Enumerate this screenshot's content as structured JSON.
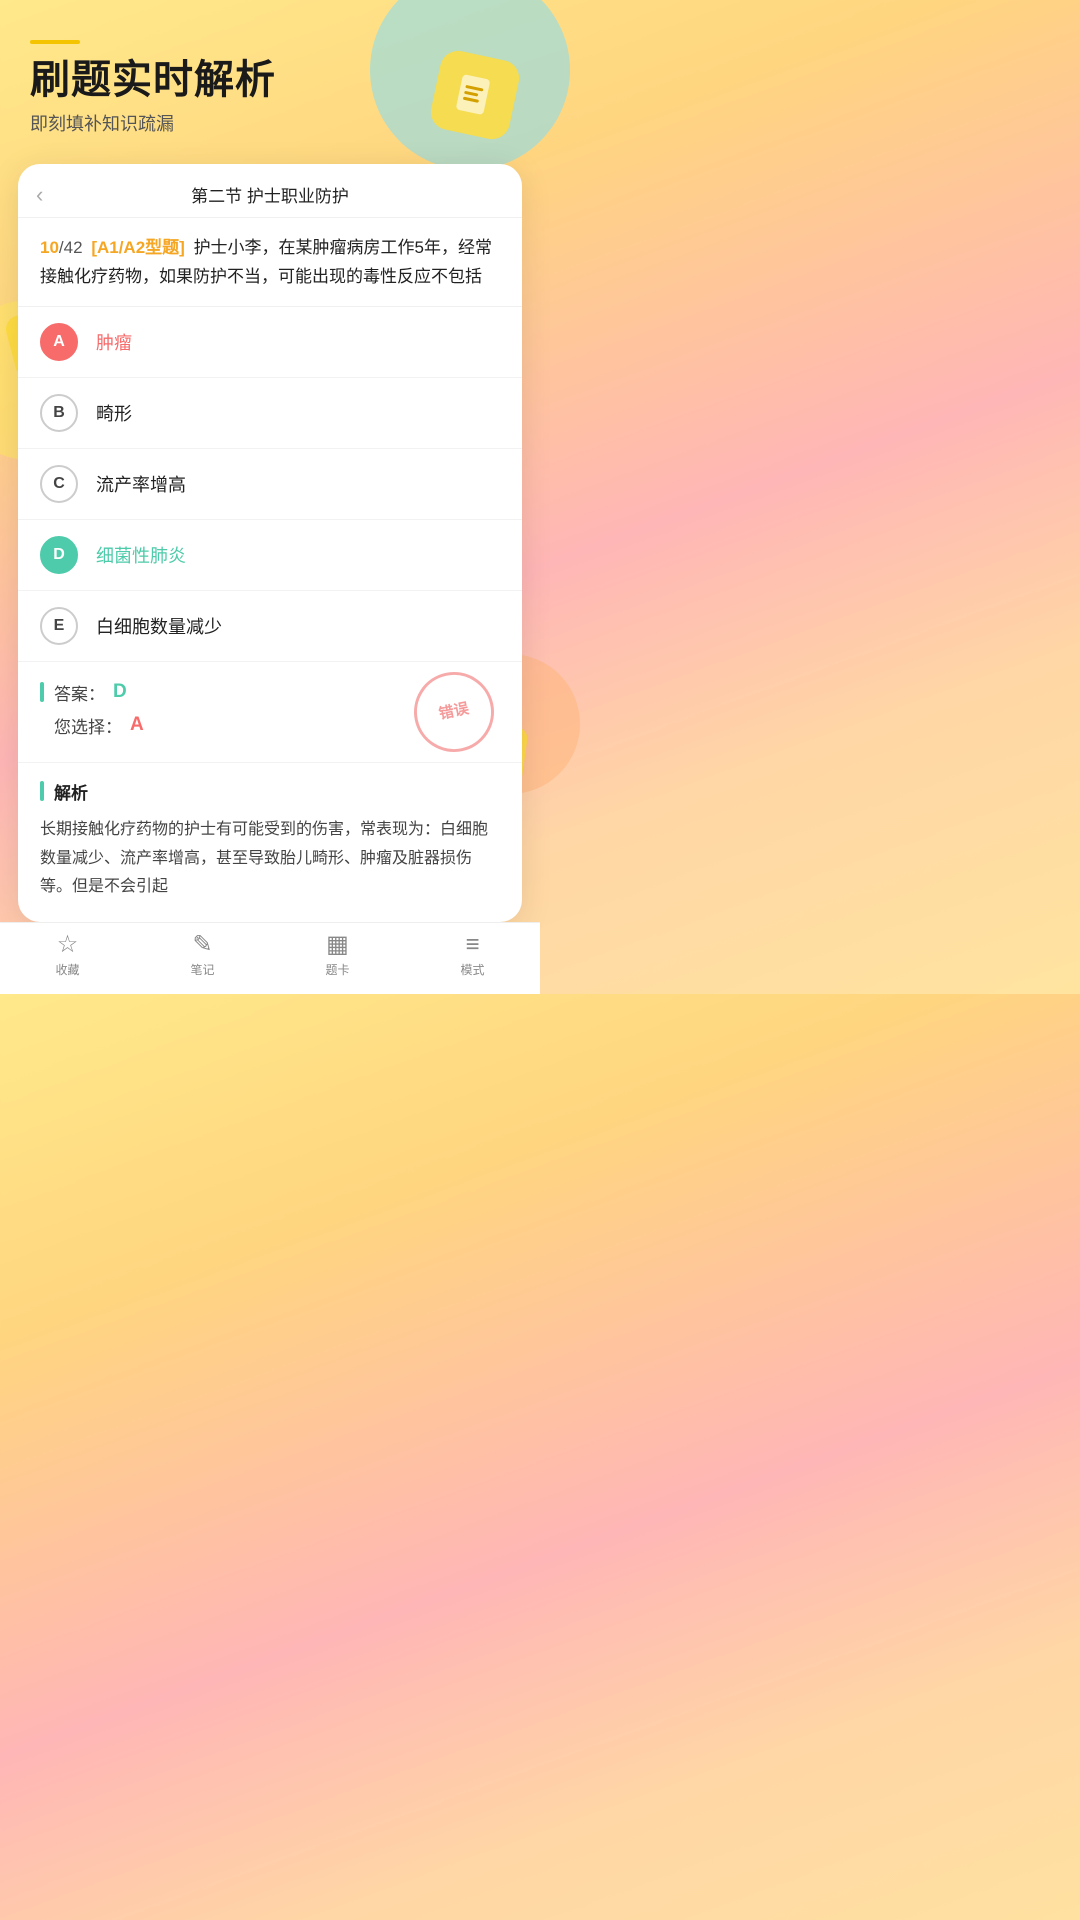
{
  "header": {
    "accent_line": true,
    "title": "刷题实时解析",
    "subtitle": "即刻填补知识疏漏"
  },
  "card": {
    "nav": {
      "back_icon": "‹",
      "title": "第二节 护士职业防护"
    },
    "question": {
      "current": "10",
      "total": "42",
      "tag": "[A1/A2型题]",
      "text": "护士小李，在某肿瘤病房工作5年，经常接触化疗药物，如果防护不当，可能出现的毒性反应不包括"
    },
    "options": [
      {
        "key": "A",
        "text": "肿瘤",
        "state": "selected-wrong"
      },
      {
        "key": "B",
        "text": "畸形",
        "state": "normal"
      },
      {
        "key": "C",
        "text": "流产率增高",
        "state": "normal"
      },
      {
        "key": "D",
        "text": "细菌性肺炎",
        "state": "correct"
      },
      {
        "key": "E",
        "text": "白细胞数量减少",
        "state": "normal"
      }
    ],
    "result": {
      "answer_label": "答案：",
      "answer_value": "D",
      "your_label": "您选择：",
      "your_value": "A",
      "stamp_text": "错误"
    },
    "analysis": {
      "header": "解析",
      "text": "长期接触化疗药物的护士有可能受到的伤害，常表现为：白细胞数量减少、流产率增高，甚至导致胎儿畸形、肿瘤及脏器损伤等。但是不会引起"
    }
  },
  "bottom_nav": [
    {
      "icon": "☆",
      "label": "收藏"
    },
    {
      "icon": "✎",
      "label": "笔记"
    },
    {
      "icon": "▦",
      "label": "题卡"
    },
    {
      "icon": "≡",
      "label": "模式"
    }
  ]
}
